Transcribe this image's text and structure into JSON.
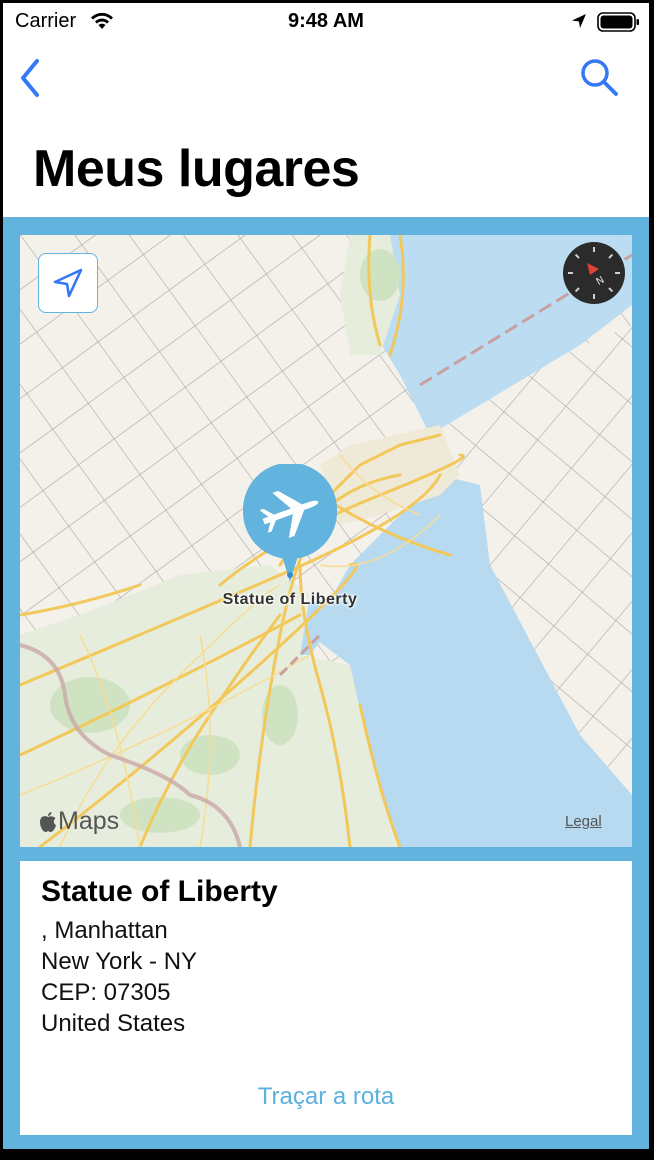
{
  "status_bar": {
    "carrier": "Carrier",
    "time": "9:48 AM"
  },
  "nav": {
    "back_icon": "chevron-left-icon",
    "search_icon": "search-icon"
  },
  "page_title": "Meus lugares",
  "map": {
    "pin_label": "Statue of Liberty",
    "pin_icon": "airplane-icon",
    "logo_text": "Maps",
    "legal_label": "Legal"
  },
  "place": {
    "name": "Statue of Liberty",
    "street": ", Manhattan",
    "city_state": "New York - NY",
    "cep": "CEP: 07305",
    "country": "United States"
  },
  "route_button": "Traçar a rota",
  "colors": {
    "accent": "#62b3dd",
    "ios_blue": "#3478f6"
  }
}
